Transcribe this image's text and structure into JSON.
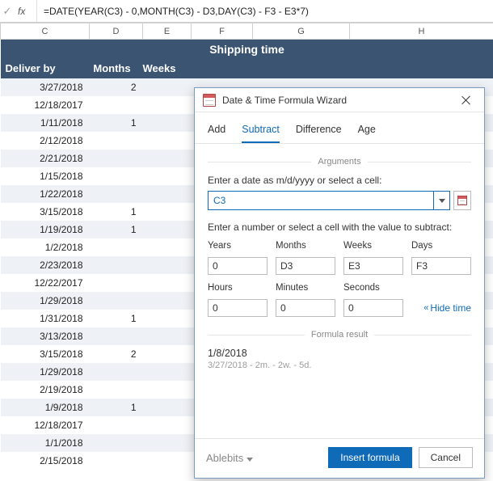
{
  "formula_bar": {
    "check_glyph": "✓",
    "fx_label": "fx",
    "formula": "=DATE(YEAR(C3) - 0,MONTH(C3) - D3,DAY(C3) - F3 - E3*7)"
  },
  "columns": [
    "C",
    "D",
    "E",
    "F",
    "G",
    "H"
  ],
  "title_banner": "Shipping time",
  "headers": {
    "deliver": "Deliver by",
    "months": "Months",
    "weeks": "Weeks"
  },
  "rows": [
    {
      "deliver": "3/27/2018",
      "months": "2",
      "stripe": true
    },
    {
      "deliver": "12/18/2017",
      "months": "",
      "stripe": false
    },
    {
      "deliver": "1/11/2018",
      "months": "1",
      "stripe": true
    },
    {
      "deliver": "2/12/2018",
      "months": "",
      "stripe": false
    },
    {
      "deliver": "2/21/2018",
      "months": "",
      "stripe": true
    },
    {
      "deliver": "1/15/2018",
      "months": "",
      "stripe": false
    },
    {
      "deliver": "1/22/2018",
      "months": "",
      "stripe": true
    },
    {
      "deliver": "3/15/2018",
      "months": "1",
      "stripe": false
    },
    {
      "deliver": "1/19/2018",
      "months": "1",
      "stripe": true
    },
    {
      "deliver": "1/2/2018",
      "months": "",
      "stripe": false
    },
    {
      "deliver": "2/23/2018",
      "months": "",
      "stripe": true
    },
    {
      "deliver": "12/22/2017",
      "months": "",
      "stripe": false
    },
    {
      "deliver": "1/29/2018",
      "months": "",
      "stripe": true
    },
    {
      "deliver": "1/31/2018",
      "months": "1",
      "stripe": false
    },
    {
      "deliver": "3/13/2018",
      "months": "",
      "stripe": true
    },
    {
      "deliver": "3/15/2018",
      "months": "2",
      "stripe": false
    },
    {
      "deliver": "1/29/2018",
      "months": "",
      "stripe": true
    },
    {
      "deliver": "2/19/2018",
      "months": "",
      "stripe": false
    },
    {
      "deliver": "1/9/2018",
      "months": "1",
      "stripe": true
    },
    {
      "deliver": "12/18/2017",
      "months": "",
      "stripe": false
    },
    {
      "deliver": "1/1/2018",
      "months": "",
      "stripe": true
    },
    {
      "deliver": "2/15/2018",
      "months": "",
      "stripe": false
    }
  ],
  "dialog": {
    "title": "Date & Time Formula Wizard",
    "tabs": {
      "add": "Add",
      "subtract": "Subtract",
      "difference": "Difference",
      "age": "Age",
      "active": "subtract"
    },
    "section_arguments": "Arguments",
    "date_label": "Enter a date as m/d/yyyy or select a cell:",
    "date_value": "C3",
    "num_label": "Enter a number or select a cell with the value to subtract:",
    "fields": {
      "years_lbl": "Years",
      "years_val": "0",
      "months_lbl": "Months",
      "months_val": "D3",
      "weeks_lbl": "Weeks",
      "weeks_val": "E3",
      "days_lbl": "Days",
      "days_val": "F3",
      "hours_lbl": "Hours",
      "hours_val": "0",
      "minutes_lbl": "Minutes",
      "minutes_val": "0",
      "seconds_lbl": "Seconds",
      "seconds_val": "0"
    },
    "hide_time_label": "Hide time",
    "section_result": "Formula result",
    "result_value": "1/8/2018",
    "result_expr": "3/27/2018 - 2m. - 2w. - 5d.",
    "brand": "Ablebits",
    "insert_label": "Insert formula",
    "cancel_label": "Cancel"
  }
}
